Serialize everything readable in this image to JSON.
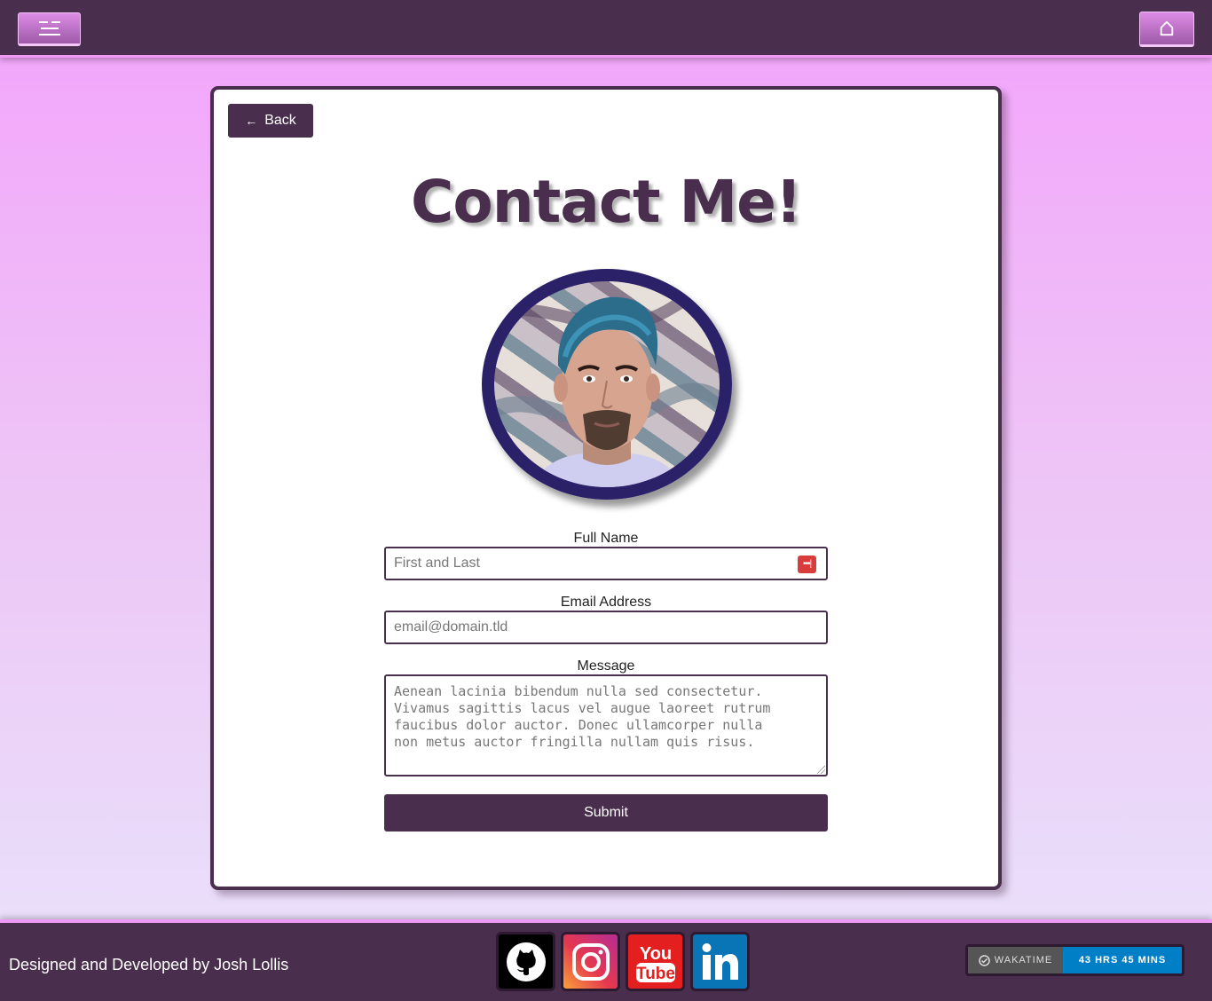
{
  "header": {
    "menu_icon": "menu-icon",
    "home_icon": "home-icon"
  },
  "card": {
    "back_label": "Back",
    "back_arrow": "←",
    "title": "Contact Me!"
  },
  "form": {
    "name_label": "Full Name",
    "name_placeholder": "First and Last",
    "email_label": "Email Address",
    "email_placeholder": "email@domain.tld",
    "message_label": "Message",
    "message_placeholder": "Aenean lacinia bibendum nulla sed consectetur.\nVivamus sagittis lacus vel augue laoreet rutrum\nfaucibus dolor auctor. Donec ullamcorper nulla\nnon metus auctor fringilla nullam quis risus.",
    "submit_label": "Submit"
  },
  "footer": {
    "credit": "Designed and Developed by Josh Lollis",
    "socials": [
      "github",
      "instagram",
      "youtube",
      "linkedin"
    ],
    "wakatime_label": "WAKATIME",
    "wakatime_value": "43 HRS 45 MINS"
  },
  "colors": {
    "primary": "#4a2e4d",
    "accent": "#ef98f5",
    "avatar_border": "#2b2169"
  }
}
